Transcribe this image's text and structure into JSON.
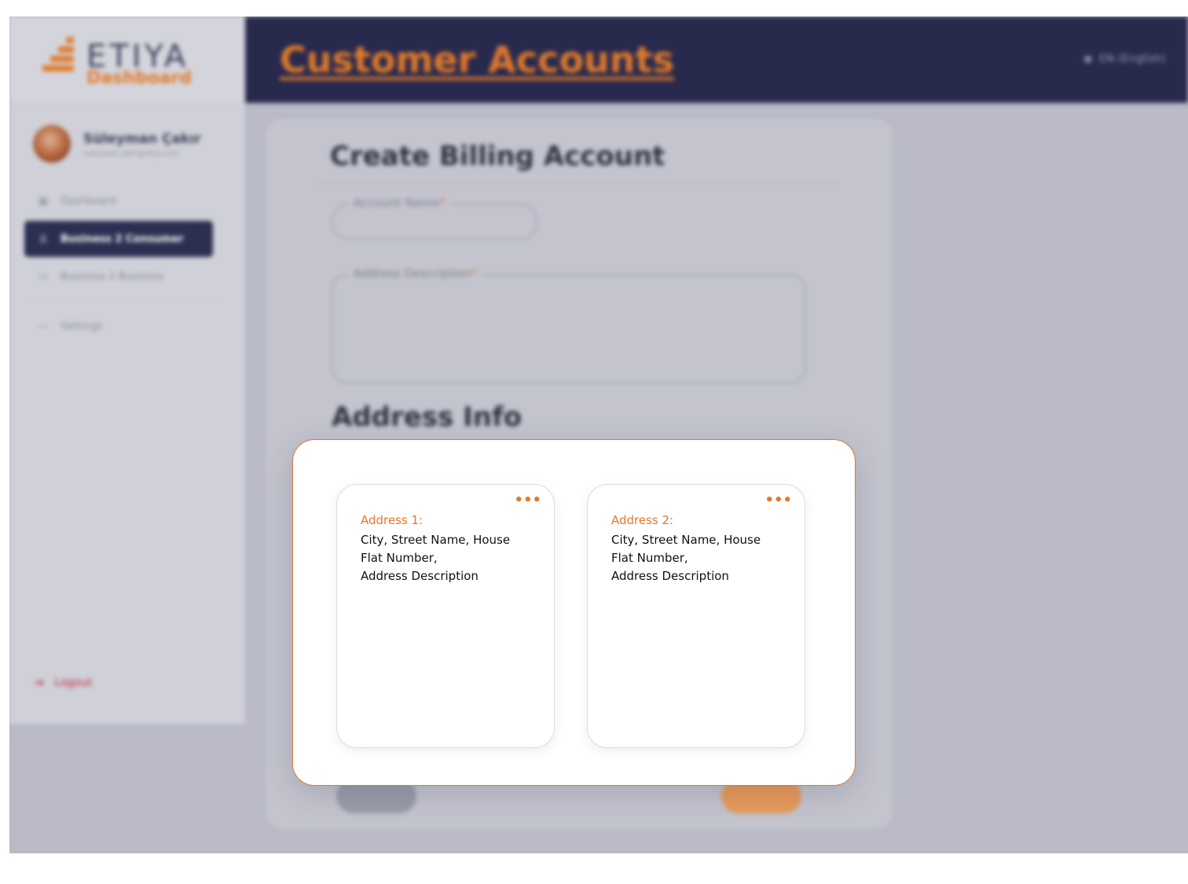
{
  "sidebar": {
    "logo_title": "ETIYA",
    "logo_sub": "Dashboard",
    "user_name": "Süleyman Çakır",
    "user_email": "suleyman.cakir@etiya.com",
    "nav": [
      {
        "label": "Dashboard",
        "icon": "grid-icon"
      },
      {
        "label": "Business 2 Consumer",
        "icon": "user-icon"
      },
      {
        "label": "Business 2 Business",
        "icon": "briefcase-icon"
      },
      {
        "label": "Settings",
        "icon": "settings-icon"
      }
    ],
    "logout_label": "Logout"
  },
  "header": {
    "title": "Customer Accounts",
    "language": "EN (English)"
  },
  "form": {
    "title": "Create Billing Account",
    "account_name_label": "Account Name",
    "address_description_label": "Address Description",
    "required_mark": "*",
    "section_title": "Address Info"
  },
  "addresses": [
    {
      "label": "Address 1:",
      "line1": "City, Street Name, House",
      "line2": "Flat Number,",
      "line3": "Address Description",
      "menu": "•••"
    },
    {
      "label": "Address 2:",
      "line1": "City, Street Name, House",
      "line2": "Flat Number,",
      "line3": "Address Description",
      "menu": "•••"
    }
  ],
  "colors": {
    "accent": "#e07a2c",
    "navy": "#27294d"
  }
}
